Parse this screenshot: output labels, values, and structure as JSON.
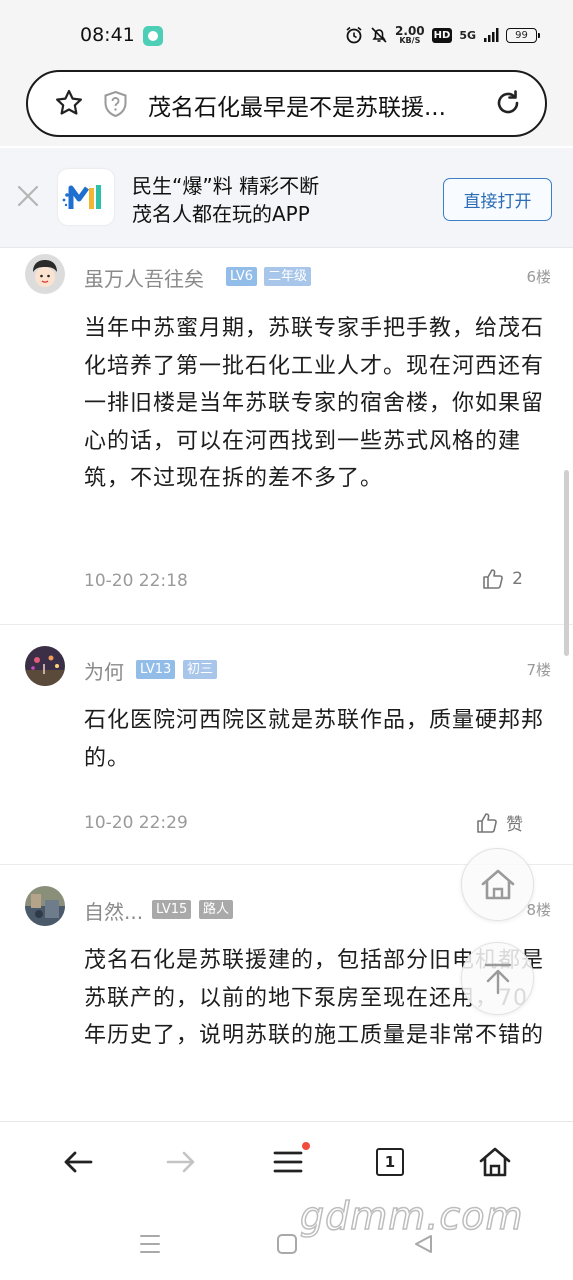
{
  "status_bar": {
    "time": "08:41",
    "speed_value": "2.00",
    "speed_unit": "KB/S",
    "hd": "HD",
    "signal": "5G",
    "battery": "99"
  },
  "address_bar": {
    "title": "茂名石化最早是不是苏联援..."
  },
  "app_banner": {
    "line1": "民生“爆”料 精彩不断",
    "line2": "茂名人都在玩的APP",
    "open_label": "直接打开"
  },
  "posts": [
    {
      "username": "虽万人吾往矣",
      "level": "LV6",
      "rank": "二年级",
      "floor": "6楼",
      "content": "当年中苏蜜月期，苏联专家手把手教，给茂石化培养了第一批石化工业人才。现在河西还有一排旧楼是当年苏联专家的宿舍楼，你如果留心的话，可以在河西找到一些苏式风格的建筑，不过现在拆的差不多了。",
      "time": "10-20 22:18",
      "likes": "2"
    },
    {
      "username": "为何",
      "level": "LV13",
      "rank": "初三",
      "floor": "7楼",
      "content": "石化医院河西院区就是苏联作品，质量硬邦邦的。",
      "time": "10-20 22:29",
      "likes": "赞"
    },
    {
      "username": "自然...",
      "level": "LV15",
      "rank": "路人",
      "floor": "8楼",
      "content": "茂名石化是苏联援建的，包括部分旧电机都是苏联产的，以前的地下泵房至现在还用，70年历史了，说明苏联的施工质量是非常不错的"
    }
  ],
  "toolbar": {
    "tab_count": "1"
  },
  "watermark": "gdmm.com"
}
